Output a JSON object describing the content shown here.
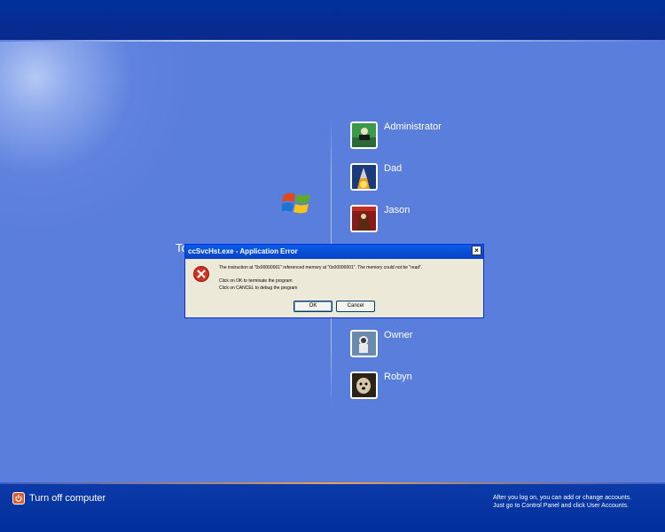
{
  "users": [
    {
      "name": "Administrator",
      "icon": "chess-avatar"
    },
    {
      "name": "Dad",
      "icon": "rocket-avatar"
    },
    {
      "name": "Jason",
      "icon": "horse-avatar"
    },
    {
      "name": "Owner",
      "icon": "astronaut-avatar"
    },
    {
      "name": "Robyn",
      "icon": "dog-avatar"
    }
  ],
  "welcome_fragment": "To",
  "turn_off": {
    "label": "Turn off computer"
  },
  "hint": {
    "line1": "After you log on, you can add or change accounts.",
    "line2": "Just go to Control Panel and click User Accounts."
  },
  "dialog": {
    "title": "ccSvcHst.exe - Application Error",
    "message": "The instruction at \"0x00000001\" referenced memory at \"0x00000001\". The memory could not be \"read\".",
    "line_ok": "Click on OK to terminate the program",
    "line_cancel": "Click on CANCEL to debug the program",
    "ok_label": "OK",
    "cancel_label": "Cancel",
    "close_glyph": "×"
  },
  "colors": {
    "background": "#5a7edc",
    "top_bar": "#00309c",
    "dialog_title": "#0842c7",
    "error_red": "#d4301f"
  }
}
